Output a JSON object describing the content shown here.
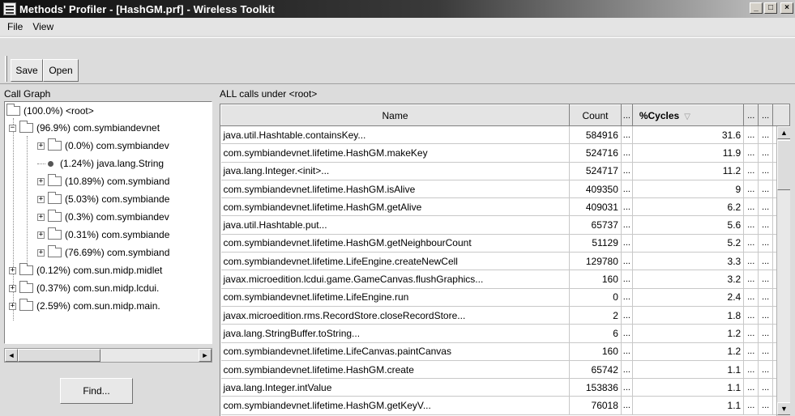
{
  "window": {
    "title": "Methods' Profiler - [HashGM.prf] - Wireless Toolkit",
    "minimize": "_",
    "maximize": "□",
    "close": "×"
  },
  "menu": {
    "file": "File",
    "view": "View"
  },
  "toolbar": {
    "save_label": "Save",
    "open_label": "Open"
  },
  "call_graph": {
    "label": "Call Graph",
    "items": [
      {
        "label": "(100.0%) <root>",
        "type": "folder"
      },
      {
        "label": "(96.9%) com.symbiandevnet",
        "type": "folder",
        "expander": "−"
      },
      {
        "label": "(0.0%) com.symbiandev",
        "type": "folder",
        "expander": "+"
      },
      {
        "label": "(1.24%) java.lang.String",
        "type": "leaf"
      },
      {
        "label": "(10.89%) com.symbiand",
        "type": "folder",
        "expander": "+"
      },
      {
        "label": "(5.03%) com.symbiande",
        "type": "folder",
        "expander": "+"
      },
      {
        "label": "(0.3%) com.symbiandev",
        "type": "folder",
        "expander": "+"
      },
      {
        "label": "(0.31%) com.symbiande",
        "type": "folder",
        "expander": "+"
      },
      {
        "label": "(76.69%) com.symbiand",
        "type": "folder",
        "expander": "+"
      },
      {
        "label": "(0.12%) com.sun.midp.midlet",
        "type": "folder",
        "expander": "+"
      },
      {
        "label": "(0.37%) com.sun.midp.lcdui.",
        "type": "folder",
        "expander": "+"
      },
      {
        "label": "(2.59%) com.sun.midp.main.",
        "type": "folder",
        "expander": "+"
      }
    ],
    "scroll_left": "◄",
    "scroll_right": "►",
    "find_label": "Find..."
  },
  "calls": {
    "label": "ALL calls under <root>",
    "columns": {
      "name": "Name",
      "count": "Count",
      "cycles": "%Cycles",
      "dots": "...",
      "sort_arrow": "▽"
    },
    "rows": [
      {
        "name": "java.util.Hashtable.containsKey...",
        "count": "584916",
        "cycles": "31.6"
      },
      {
        "name": "com.symbiandevnet.lifetime.HashGM.makeKey",
        "count": "524716",
        "cycles": "11.9"
      },
      {
        "name": "java.lang.Integer.<init>...",
        "count": "524717",
        "cycles": "11.2"
      },
      {
        "name": "com.symbiandevnet.lifetime.HashGM.isAlive",
        "count": "409350",
        "cycles": "9"
      },
      {
        "name": "com.symbiandevnet.lifetime.HashGM.getAlive",
        "count": "409031",
        "cycles": "6.2"
      },
      {
        "name": "java.util.Hashtable.put...",
        "count": "65737",
        "cycles": "5.6"
      },
      {
        "name": "com.symbiandevnet.lifetime.HashGM.getNeighbourCount",
        "count": "51129",
        "cycles": "5.2"
      },
      {
        "name": "com.symbiandevnet.lifetime.LifeEngine.createNewCell",
        "count": "129780",
        "cycles": "3.3"
      },
      {
        "name": "javax.microedition.lcdui.game.GameCanvas.flushGraphics...",
        "count": "160",
        "cycles": "3.2"
      },
      {
        "name": "com.symbiandevnet.lifetime.LifeEngine.run",
        "count": "0",
        "cycles": "2.4"
      },
      {
        "name": "javax.microedition.rms.RecordStore.closeRecordStore...",
        "count": "2",
        "cycles": "1.8"
      },
      {
        "name": "java.lang.StringBuffer.toString...",
        "count": "6",
        "cycles": "1.2"
      },
      {
        "name": "com.symbiandevnet.lifetime.LifeCanvas.paintCanvas",
        "count": "160",
        "cycles": "1.2"
      },
      {
        "name": "com.symbiandevnet.lifetime.HashGM.create",
        "count": "65742",
        "cycles": "1.1"
      },
      {
        "name": "java.lang.Integer.intValue",
        "count": "153836",
        "cycles": "1.1"
      },
      {
        "name": "com.symbiandevnet.lifetime.HashGM.getKeyV...",
        "count": "76018",
        "cycles": "1.1"
      }
    ],
    "scroll_up": "▲",
    "scroll_down": "▼"
  }
}
